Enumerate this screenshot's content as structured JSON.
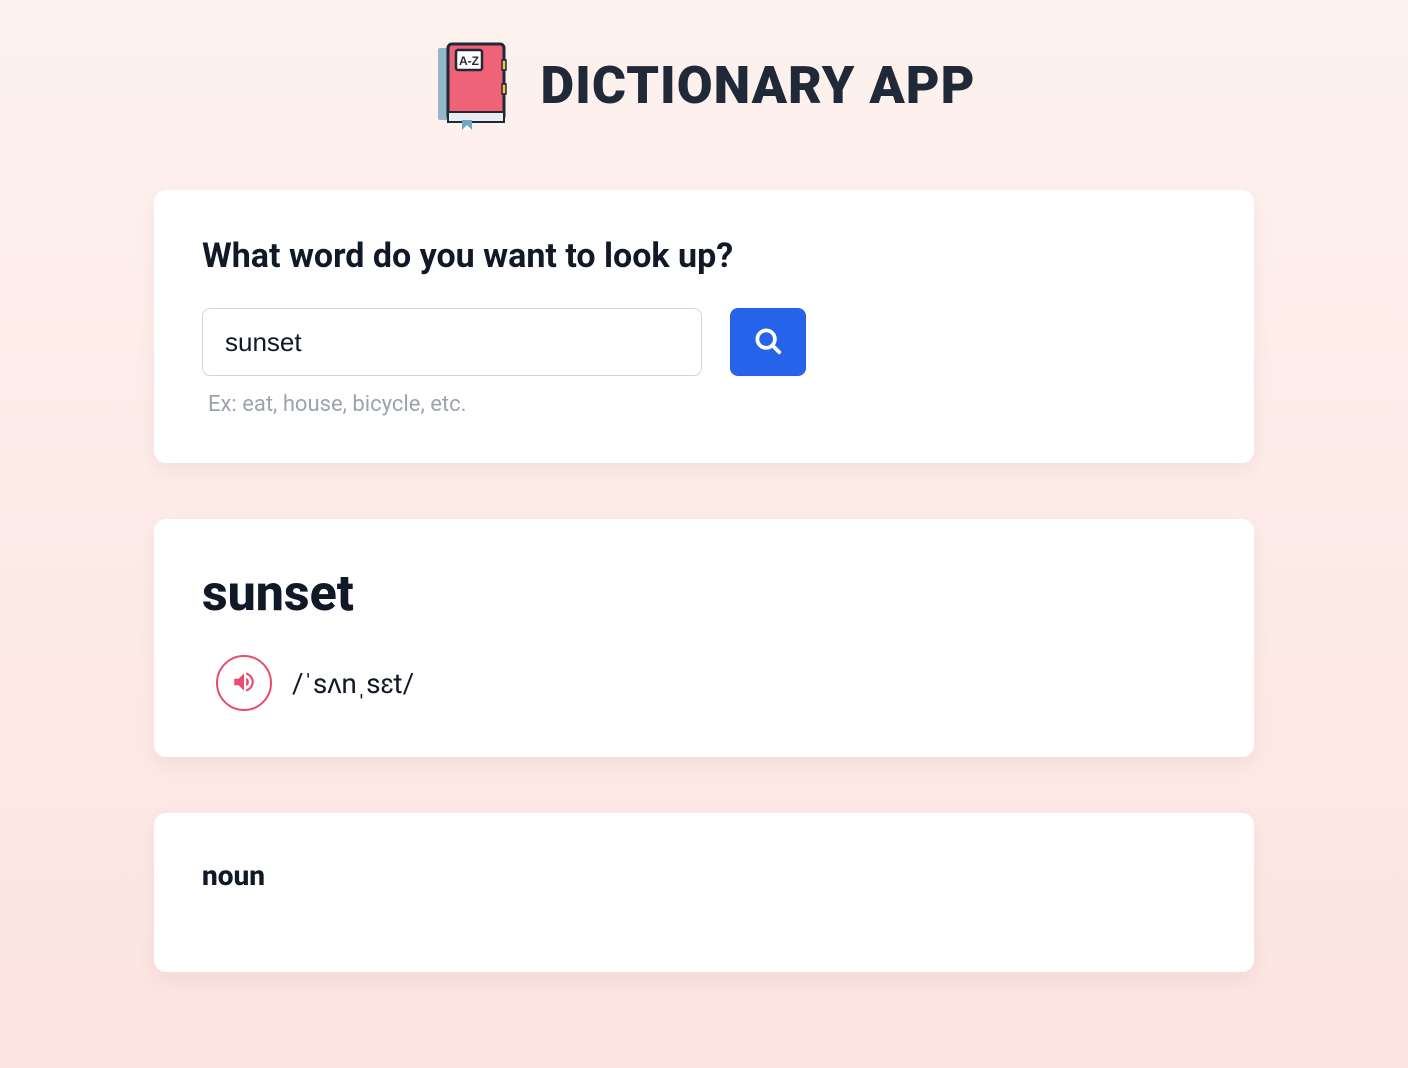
{
  "header": {
    "title": "Dictionary App",
    "logo_label": "A-Z"
  },
  "search": {
    "prompt": "What word do you want to look up?",
    "value": "sunset",
    "placeholder": "",
    "hint": "Ex: eat, house, bicycle, etc."
  },
  "result": {
    "word": "sunset",
    "phonetic": "/ˈsʌnˌsɛt/",
    "meanings": [
      {
        "part_of_speech": "noun"
      }
    ]
  },
  "colors": {
    "accent": "#2563eb",
    "audio_ring": "#ec4b6d"
  }
}
